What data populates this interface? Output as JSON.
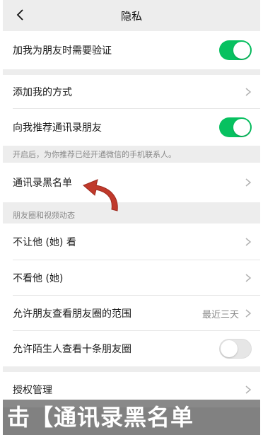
{
  "nav": {
    "title": "隐私"
  },
  "rows": {
    "verify": "加我为朋友时需要验证",
    "add_methods": "添加我的方式",
    "recommend_contacts": "向我推荐通讯录朋友",
    "blacklist": "通讯录黑名单",
    "dont_let_see": "不让他 (她) 看",
    "dont_see": "不看他 (她)",
    "moments_range": "允许朋友查看朋友圈的范围",
    "moments_range_value": "最近三天",
    "stranger_ten": "允许陌生人查看十条朋友圈",
    "auth_manage": "授权管理"
  },
  "toggles": {
    "verify": true,
    "recommend_contacts": true,
    "stranger_ten": false
  },
  "note_recommend": "开启后，为你推荐已经开通微信的手机联系人。",
  "section_moments": "朋友圈和视频动态",
  "caption": "击【通讯录黑名单",
  "colors": {
    "accent": "#07c160",
    "arrow": "#c0392b"
  }
}
